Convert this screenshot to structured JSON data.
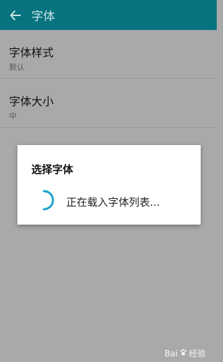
{
  "appbar": {
    "back_icon": "arrow-left-icon",
    "title": "字体"
  },
  "settings": [
    {
      "label": "字体样式",
      "value": "默认"
    },
    {
      "label": "字体大小",
      "value": "中"
    }
  ],
  "dialog": {
    "title": "选择字体",
    "spinner_icon": "loading-spinner-icon",
    "message": "正在载入字体列表..."
  },
  "watermark": {
    "left": "Bai",
    "right": "经验"
  },
  "colors": {
    "appbar": "#06737f",
    "spinner": "#1aa3c8",
    "scrim": "#a9a9a9"
  }
}
